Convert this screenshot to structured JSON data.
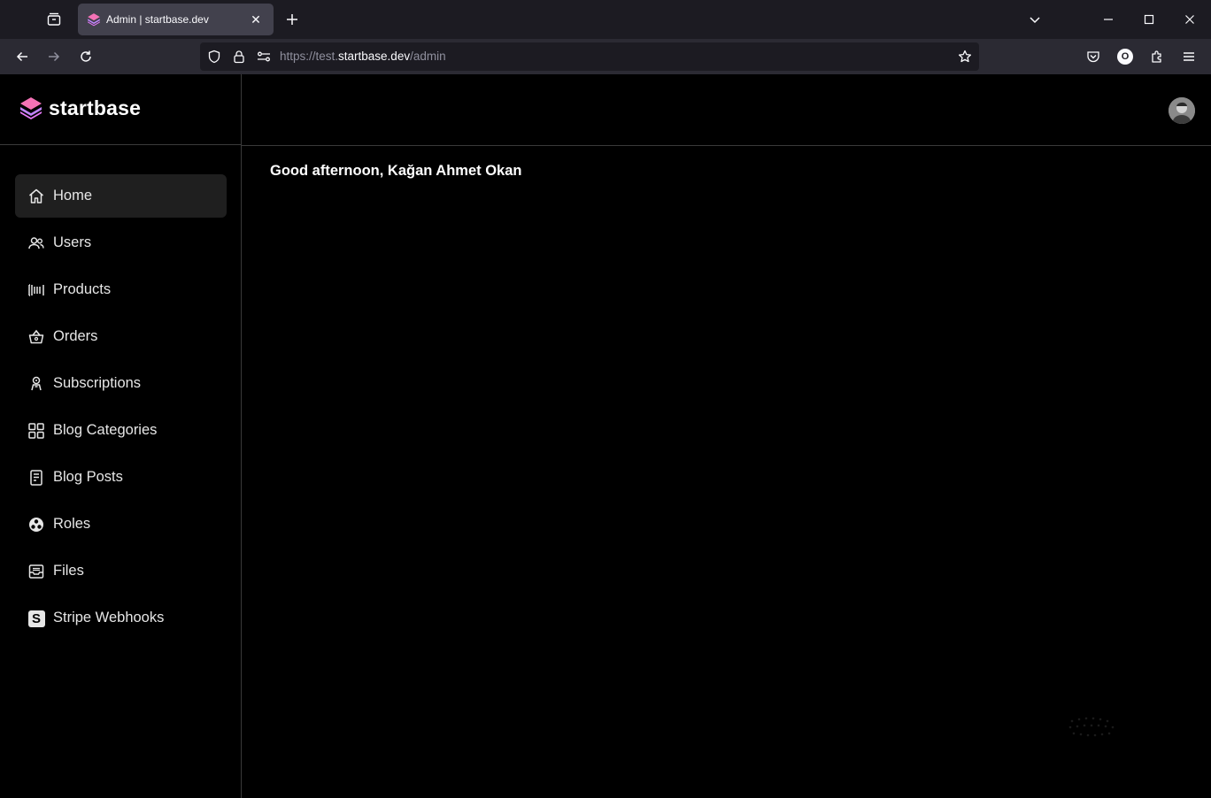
{
  "browser": {
    "tab": {
      "title": "Admin | startbase.dev",
      "close_label": "✕"
    },
    "url": {
      "scheme": "https://test.",
      "domain": "startbase.dev",
      "path": "/admin"
    },
    "icons": [
      "list-all-tabs-icon",
      "new-tab-icon",
      "chevron-down-icon",
      "minimize-icon",
      "maximize-icon",
      "close-icon",
      "back-icon",
      "forward-icon",
      "reload-icon",
      "shield-icon",
      "lock-icon",
      "permissions-icon",
      "bookmark-star-icon",
      "pocket-icon",
      "account-icon",
      "extensions-icon",
      "menu-icon"
    ],
    "account_initial": "O"
  },
  "app": {
    "brand": {
      "name": "startbase",
      "logo_colors": [
        "#f472b6",
        "#c084fc",
        "#e879f9"
      ]
    },
    "sidebar": {
      "items": [
        {
          "label": "Home",
          "icon": "home-icon",
          "active": true
        },
        {
          "label": "Users",
          "icon": "users-icon",
          "active": false
        },
        {
          "label": "Products",
          "icon": "barcode-icon",
          "active": false
        },
        {
          "label": "Orders",
          "icon": "basket-icon",
          "active": false
        },
        {
          "label": "Subscriptions",
          "icon": "subscriptions-icon",
          "active": false
        },
        {
          "label": "Blog Categories",
          "icon": "grid-icon",
          "active": false
        },
        {
          "label": "Blog Posts",
          "icon": "document-icon",
          "active": false
        },
        {
          "label": "Roles",
          "icon": "roles-icon",
          "active": false
        },
        {
          "label": "Files",
          "icon": "archive-icon",
          "active": false
        },
        {
          "label": "Stripe Webhooks",
          "icon": "stripe-icon",
          "active": false
        }
      ]
    },
    "header": {
      "avatar": "user-avatar"
    },
    "main": {
      "greeting": "Good afternoon, Kağan Ahmet Okan"
    },
    "stripe_glyph": "S"
  },
  "colors": {
    "background": "#000000",
    "tabbar": "#1c1b22",
    "navbar": "#2b2a33",
    "active_tab": "#42414d",
    "active_nav": "#1f1f1f",
    "border": "#3a3a3a"
  }
}
